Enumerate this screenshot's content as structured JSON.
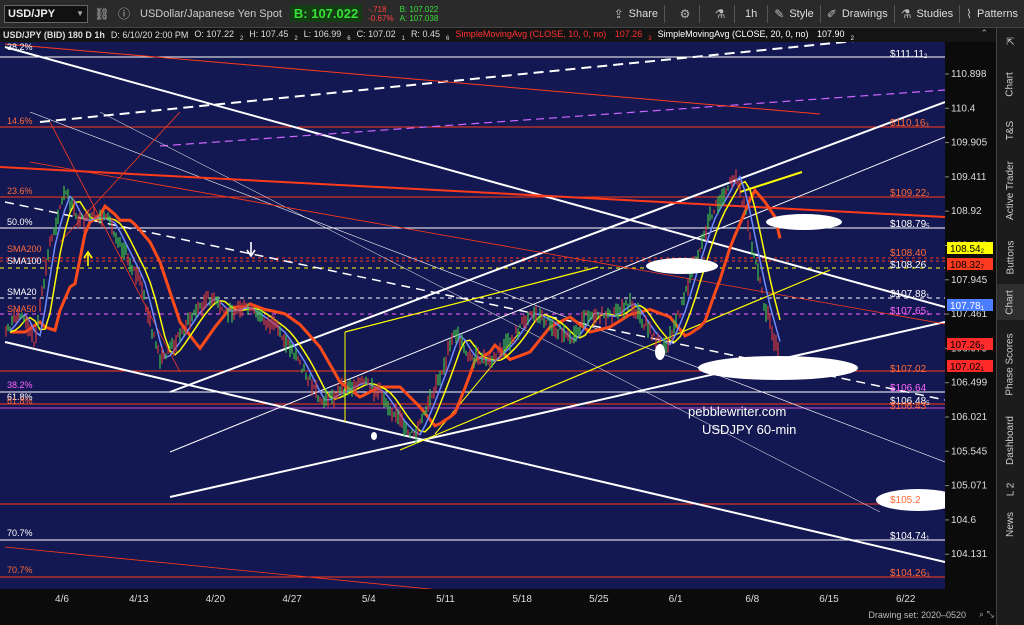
{
  "toolbar": {
    "symbol": "USD/JPY",
    "description": "USDollar/Japanese Yen Spot",
    "last_price": "B: 107.022",
    "net_change": "-.718",
    "pct_change": "-0.67%",
    "bid": "B: 107.022",
    "ask": "A: 107.038",
    "share_label": "Share",
    "timeframe_label": "1h",
    "style_label": "Style",
    "drawings_label": "Drawings",
    "studies_label": "Studies",
    "patterns_label": "Patterns"
  },
  "infobar": {
    "title": "USD/JPY (BID) 180 D 1h",
    "datetime": "D: 6/10/20 2:00 PM",
    "open": "O: 107.22",
    "open_sub": "2",
    "high": "H: 107.45",
    "high_sub": "2",
    "low": "L: 106.99",
    "low_sub": "6",
    "close": "C: 107.02",
    "close_sub": "1",
    "range": "R: 0.45",
    "range_sub": "6",
    "sma10_label": "SimpleMovingAvg (CLOSE, 10, 0, no)",
    "sma10_value": "107.26",
    "sma10_value_sub": "3",
    "sma20_label": "SimpleMovingAvg (CLOSE, 20, 0, no)",
    "sma20_value": "107.90",
    "sma20_value_sub": "2"
  },
  "chart": {
    "fib_labels": [
      {
        "text": "38.2%",
        "color": "#ffffff"
      },
      {
        "text": "14.6%",
        "color": "#ff6a3a"
      },
      {
        "text": "23.6%",
        "color": "#ff6a3a"
      },
      {
        "text": "50.0%",
        "color": "#ffffff"
      },
      {
        "text": "SMA200",
        "color": "#ff6a3a"
      },
      {
        "text": "SMA100",
        "color": "#ffffff"
      },
      {
        "text": "SMA20",
        "color": "#ffffff"
      },
      {
        "text": "SMA50",
        "color": "#ff6a3a"
      },
      {
        "text": "38.2%",
        "color": "#ff66ff"
      },
      {
        "text": "61.8%",
        "color": "#ffffff"
      },
      {
        "text": "61.8%",
        "color": "#ff6a3a"
      },
      {
        "text": "70.7%",
        "color": "#ffffff"
      },
      {
        "text": "70.7%",
        "color": "#ff6a3a"
      }
    ],
    "level_labels": [
      {
        "text": "$111.11",
        "sub": "2",
        "color": "#ffffff"
      },
      {
        "text": "$110.16",
        "sub": "3",
        "color": "#ff6a3a"
      },
      {
        "text": "$109.22",
        "sub": "2",
        "color": "#ff6a3a"
      },
      {
        "text": "$108.79",
        "sub": "5",
        "color": "#ffffff"
      },
      {
        "text": "$108.40",
        "sub": "",
        "color": "#ff6a3a"
      },
      {
        "text": "$108.26",
        "sub": "",
        "color": "#ffffff"
      },
      {
        "text": "$107.88",
        "sub": "1",
        "color": "#ffffff"
      },
      {
        "text": "$107.65",
        "sub": "1",
        "color": "#ff66ff"
      },
      {
        "text": "$107.02",
        "sub": "",
        "color": "#ff6a3a"
      },
      {
        "text": "$106.64",
        "sub": "",
        "color": "#ff66ff"
      },
      {
        "text": "$106.48",
        "sub": "5",
        "color": "#ffffff"
      },
      {
        "text": "$106.43",
        "sub": "",
        "color": "#ff6a3a"
      },
      {
        "text": "$105.2",
        "sub": "",
        "color": "#ff6a3a"
      },
      {
        "text": "$104.74",
        "sub": "1",
        "color": "#ffffff"
      },
      {
        "text": "$104.26",
        "sub": "3",
        "color": "#ff6a3a"
      }
    ],
    "watermark_site": "pebblewriter.com",
    "watermark_desc": "USDJPY 60-min"
  },
  "yaxis": {
    "ticks": [
      "110.898",
      "110.4",
      "109.905",
      "109.411",
      "108.92",
      "108.433",
      "107.945",
      "107.461",
      "106.979",
      "106.499",
      "106.021",
      "105.545",
      "105.071",
      "104.6",
      "104.131"
    ],
    "price_tags": [
      {
        "text": "108.54",
        "sub": "2",
        "bg": "#ffff00",
        "fg": "#000000"
      },
      {
        "text": "108.32",
        "sub": "7",
        "bg": "#ff3b1f",
        "fg": "#000000"
      },
      {
        "text": "107.78",
        "sub": "1",
        "bg": "#4a7dff",
        "fg": "#ffffff"
      },
      {
        "text": "107.26",
        "sub": "3",
        "bg": "#ff2a2a",
        "fg": "#000000"
      },
      {
        "text": "107.02",
        "sub": "1",
        "bg": "#ff2a2a",
        "fg": "#000000"
      }
    ]
  },
  "xaxis": {
    "ticks": [
      "4/6",
      "4/13",
      "4/20",
      "4/27",
      "5/4",
      "5/11",
      "5/18",
      "5/25",
      "6/1",
      "6/8",
      "6/15",
      "6/22"
    ]
  },
  "status": {
    "drawing_set": "Drawing set: 2020–0520"
  },
  "sidepanel": {
    "tabs": [
      "Chart",
      "T&S",
      "Active Trader",
      "Buttons",
      "Chart",
      "Phase Scores",
      "Dashboard",
      "L 2",
      "News"
    ]
  },
  "colors": {
    "chart_bg": "#141852",
    "sma10": "#ffff00",
    "sma20": "#6e8bff",
    "sma50": "#ff2a2a",
    "sma200": "#ff4a1a"
  }
}
